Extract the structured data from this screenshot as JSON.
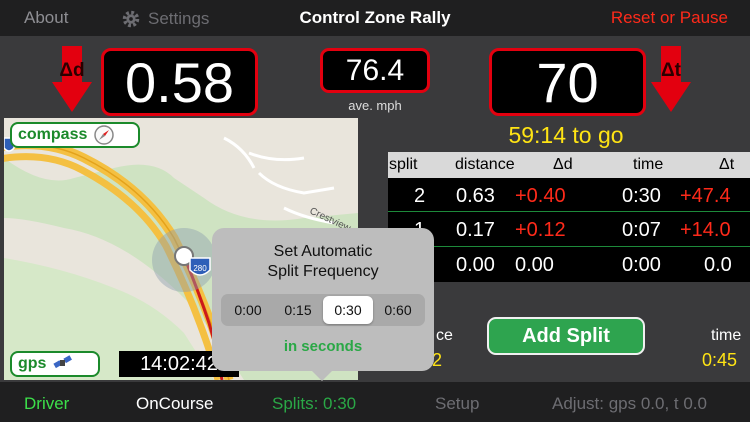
{
  "topbar": {
    "about": "About",
    "settings": "Settings",
    "title": "Control Zone Rally",
    "reset": "Reset or Pause"
  },
  "metrics": {
    "dd_label": "Δd",
    "dd_value": "0.58",
    "speed_value": "76.4",
    "speed_unit": "ave. mph",
    "dt_value": "70",
    "dt_label": "Δt",
    "to_go": "59:14 to go"
  },
  "map": {
    "compass_label": "compass",
    "gps_label": "gps",
    "clock": "14:02:42",
    "road_label": "Crestview",
    "shield_number": "280"
  },
  "table": {
    "headers": [
      "split",
      "distance",
      "Δd",
      "time",
      "Δt"
    ],
    "rows": [
      {
        "split": "2",
        "distance": "0.63",
        "dd": "+0.40",
        "time": "0:30",
        "dt": "+47.4"
      },
      {
        "split": "1",
        "distance": "0.17",
        "dd": "+0.12",
        "time": "0:07",
        "dt": "+14.0"
      },
      {
        "split": "",
        "distance": "0.00",
        "dd": "0.00",
        "time": "0:00",
        "dt": "0.0"
      }
    ]
  },
  "controls": {
    "add_split": "Add Split",
    "distance_label": "ce",
    "distance_value": "2",
    "time_label": "time",
    "time_value": "0:45"
  },
  "popover": {
    "title_line1": "Set Automatic",
    "title_line2": "Split Frequency",
    "options": [
      "0:00",
      "0:15",
      "0:30",
      "0:60"
    ],
    "selected_index": 2,
    "note": "in seconds"
  },
  "bottombar": {
    "driver": "Driver",
    "oncourse": "OnCourse",
    "splits": "Splits: 0:30",
    "setup": "Setup",
    "adjust": "Adjust: gps 0.0, t 0.0"
  },
  "colors": {
    "accent_red": "#e3000f",
    "accent_yellow": "#ffe414",
    "accent_green": "#2ea44f",
    "bar_bg": "#1f1f20"
  }
}
